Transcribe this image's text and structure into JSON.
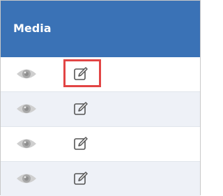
{
  "table": {
    "column_header": "Media",
    "rows": [
      {
        "view_icon": "eye-icon",
        "edit_icon": "edit-icon",
        "highlighted": true
      },
      {
        "view_icon": "eye-icon",
        "edit_icon": "edit-icon",
        "highlighted": false
      },
      {
        "view_icon": "eye-icon",
        "edit_icon": "edit-icon",
        "highlighted": false
      },
      {
        "view_icon": "eye-icon",
        "edit_icon": "edit-icon",
        "highlighted": false
      }
    ]
  },
  "colors": {
    "header_bg": "#3a72b6",
    "header_text": "#ffffff",
    "row_alt_bg": "#eef1f7",
    "icon_gray": "#b4b4b4",
    "edit_icon": "#555555",
    "highlight": "#e24545"
  }
}
